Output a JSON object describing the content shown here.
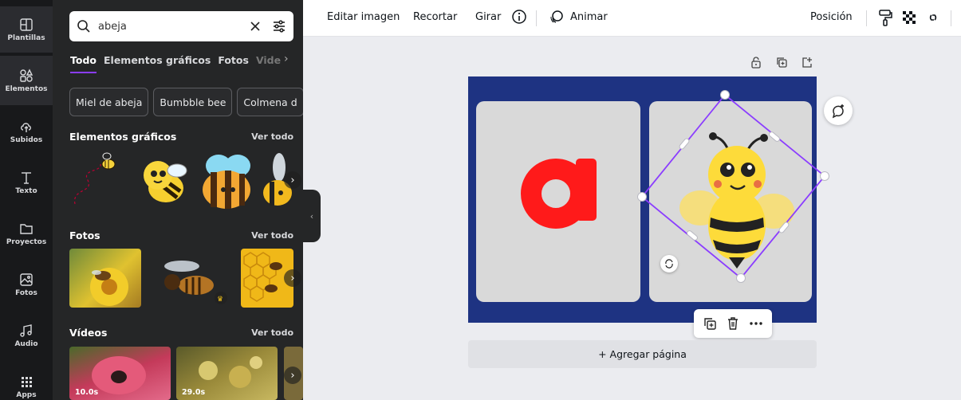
{
  "rail": {
    "items": [
      {
        "label": "Plantillas",
        "icon": "template-icon"
      },
      {
        "label": "Elementos",
        "icon": "elements-icon"
      },
      {
        "label": "Subidos",
        "icon": "upload-cloud-icon"
      },
      {
        "label": "Texto",
        "icon": "text-icon"
      },
      {
        "label": "Proyectos",
        "icon": "folder-icon"
      },
      {
        "label": "Fotos",
        "icon": "photo-icon"
      },
      {
        "label": "Audio",
        "icon": "music-icon"
      },
      {
        "label": "Apps",
        "icon": "apps-grid-icon"
      }
    ]
  },
  "search": {
    "value": "abeja"
  },
  "tabs": [
    "Todo",
    "Elementos gráficos",
    "Fotos",
    "Vide"
  ],
  "chips": [
    "Miel de abeja",
    "Bumbble bee",
    "Colmena d"
  ],
  "sections": {
    "graphics": {
      "title": "Elementos gráficos",
      "see_all": "Ver todo"
    },
    "photos": {
      "title": "Fotos",
      "see_all": "Ver todo"
    },
    "videos": {
      "title": "Vídeos",
      "see_all": "Ver todo",
      "durations": [
        "10.0s",
        "29.0s"
      ]
    }
  },
  "toolbar": {
    "edit_image": "Editar imagen",
    "crop": "Recortar",
    "flip": "Girar",
    "animate": "Animar",
    "position": "Posición"
  },
  "canvas": {
    "letter": "a",
    "add_page": "+ Agregar página"
  },
  "colors": {
    "accent": "#8b3dff",
    "page_bg": "#1e3382",
    "card_bg": "#d9d9d9",
    "letter": "#ff1a1a",
    "bee_yellow": "#fddb3a"
  }
}
